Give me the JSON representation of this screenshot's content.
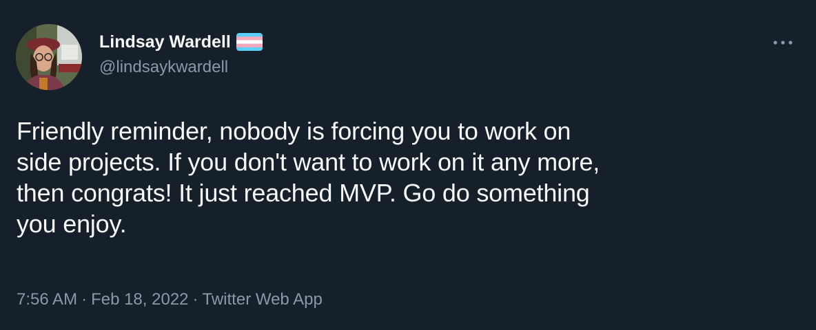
{
  "author": {
    "display_name": "Lindsay Wardell",
    "handle": "@lindsaykwardell",
    "avatar_icon": "profile-photo",
    "flag_icon": "transgender-flag-icon"
  },
  "tweet": {
    "text": "Friendly reminder, nobody is forcing you to work on\nside projects. If you don't want to work on it any more,\nthen congrats! It just reached MVP. Go do something\nyou enjoy."
  },
  "meta": {
    "time": "7:56 AM",
    "separator": "·",
    "date": "Feb 18, 2022",
    "source": "Twitter Web App"
  },
  "menu": {
    "icon": "more-options-icon"
  },
  "colors": {
    "background": "#15202b",
    "primary_text": "#f7f9f9",
    "secondary_text": "#8b98a5",
    "flag_blue": "#5bcefa",
    "flag_pink": "#f5a9b8",
    "flag_white": "#ffffff"
  }
}
